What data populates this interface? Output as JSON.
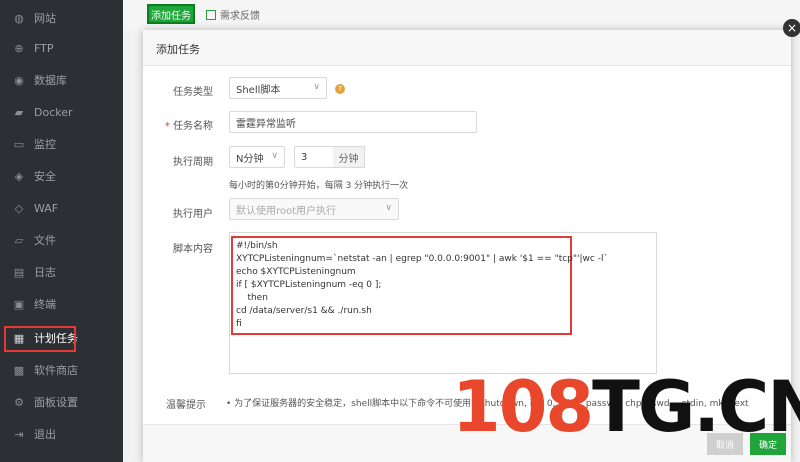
{
  "sidebar": {
    "items": [
      {
        "label": "网站",
        "icon": "globe-icon"
      },
      {
        "label": "FTP",
        "icon": "ftp-icon"
      },
      {
        "label": "数据库",
        "icon": "database-icon"
      },
      {
        "label": "Docker",
        "icon": "docker-icon"
      },
      {
        "label": "监控",
        "icon": "monitor-icon"
      },
      {
        "label": "安全",
        "icon": "shield-icon"
      },
      {
        "label": "WAF",
        "icon": "waf-shield-icon"
      },
      {
        "label": "文件",
        "icon": "folder-icon"
      },
      {
        "label": "日志",
        "icon": "log-icon"
      },
      {
        "label": "终端",
        "icon": "terminal-icon"
      },
      {
        "label": "计划任务",
        "icon": "calendar-icon"
      },
      {
        "label": "软件商店",
        "icon": "store-icon"
      },
      {
        "label": "面板设置",
        "icon": "settings-icon"
      },
      {
        "label": "退出",
        "icon": "logout-icon"
      }
    ]
  },
  "toolbar": {
    "add_task": "添加任务",
    "feedback": "需求反馈"
  },
  "modal": {
    "title": "添加任务",
    "task_type_label": "任务类型",
    "task_type_value": "Shell脚本",
    "task_name_label": "任务名称",
    "task_name_value": "雷霆异常监听",
    "period_label": "执行周期",
    "period_unit_value": "N分钟",
    "period_number_value": "3",
    "period_suffix": "分钟",
    "period_hint": "每小时的第0分钟开始，每隔 3 分钟执行一次",
    "user_label": "执行用户",
    "user_placeholder": "默认使用root用户执行",
    "script_label": "脚本内容",
    "script_lines": [
      "#!/bin/sh",
      "XYTCPListeningnum=`netstat -an | egrep \"0.0.0.0:9001\" | awk '$1 == \"tcp\"'|wc -l`",
      "echo $XYTCPListeningnum",
      "if [ $XYTCPListeningnum -eq 0 ];",
      "    then",
      "cd /data/server/s1 && ./run.sh",
      "fi"
    ],
    "tip_label": "温馨提示",
    "tip_text": "•   为了保证服务器的安全稳定，shell脚本中以下命令不可使用：shutdown, init 0, mkfs, passwd, chpasswd, --stdin, mkfs.ext",
    "cancel_label": "取消",
    "ok_label": "确定",
    "close_glyph": "×",
    "help_glyph": "?"
  },
  "watermark": {
    "red": "108",
    "black": "TG.CN"
  },
  "colors": {
    "sidebar_bg": "#2c2f33",
    "accent_green": "#20a53a",
    "highlight_red": "#e53935",
    "warning_orange": "#e5a23c"
  }
}
